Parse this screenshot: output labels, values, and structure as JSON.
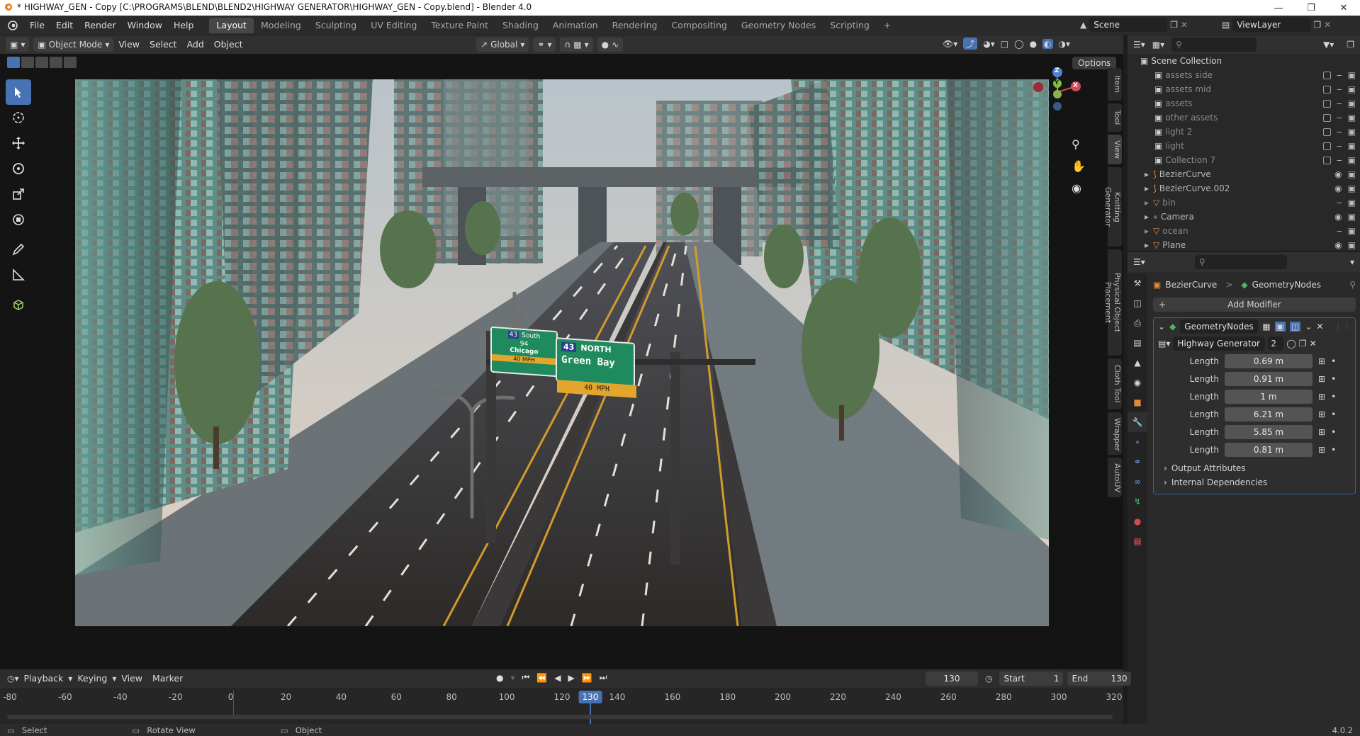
{
  "window": {
    "title": "* HIGHWAY_GEN - Copy [C:\\PROGRAMS\\BLEND\\BLEND2\\HIGHWAY GENERATOR\\HIGHWAY_GEN - Copy.blend] - Blender 4.0"
  },
  "menu": [
    "File",
    "Edit",
    "Render",
    "Window",
    "Help"
  ],
  "workspaces": [
    "Layout",
    "Modeling",
    "Sculpting",
    "UV Editing",
    "Texture Paint",
    "Shading",
    "Animation",
    "Rendering",
    "Compositing",
    "Geometry Nodes",
    "Scripting"
  ],
  "workspace_add": "+",
  "scene": {
    "name": "Scene",
    "view_layer": "ViewLayer"
  },
  "viewport": {
    "mode": "Object Mode",
    "menus": [
      "View",
      "Select",
      "Add",
      "Object"
    ],
    "transform_orientation": "Global",
    "options_label": "Options",
    "side_tabs": [
      "Item",
      "Tool",
      "View",
      "Knitting Generator",
      "Physical Object Placement",
      "Cloth Tool",
      "Wrapper",
      "AutoUV"
    ],
    "gizmo": {
      "z": "Z",
      "y": "Y",
      "x": "X"
    },
    "signs": {
      "left_route_top": "43",
      "left_route_bottom": "94",
      "left_south": "South",
      "left_city": "Chicago",
      "left_speed": "40 MPH",
      "right_route": "43",
      "right_dir": "NORTH",
      "right_city": "Green Bay",
      "right_speed": "40 MPH"
    }
  },
  "outliner": {
    "root": "Scene Collection",
    "items": [
      {
        "name": "assets side",
        "type": "collection",
        "dim": true
      },
      {
        "name": "assets mid",
        "type": "collection",
        "dim": true
      },
      {
        "name": "assets",
        "type": "collection",
        "dim": true
      },
      {
        "name": "other assets",
        "type": "collection",
        "dim": true
      },
      {
        "name": "light 2",
        "type": "collection",
        "dim": true
      },
      {
        "name": "light",
        "type": "collection",
        "dim": true
      },
      {
        "name": "Collection 7",
        "type": "collection",
        "dim": true
      },
      {
        "name": "BezierCurve",
        "type": "curve",
        "dim": false
      },
      {
        "name": "BezierCurve.002",
        "type": "curve",
        "dim": false
      },
      {
        "name": "bin",
        "type": "mesh",
        "dim": true
      },
      {
        "name": "Camera",
        "type": "camera",
        "dim": false
      },
      {
        "name": "ocean",
        "type": "mesh",
        "dim": true
      },
      {
        "name": "Plane",
        "type": "mesh",
        "dim": false
      }
    ]
  },
  "properties": {
    "breadcrumb_object": "BezierCurve",
    "breadcrumb_sep": ">",
    "breadcrumb_modifier": "GeometryNodes",
    "add_modifier": "Add Modifier",
    "modifier_name": "GeometryNodes",
    "node_group": "Highway Generator",
    "node_users": "2",
    "params": [
      {
        "label": "Length",
        "value": "0.69 m"
      },
      {
        "label": "Length",
        "value": "0.91 m"
      },
      {
        "label": "Length",
        "value": "1 m"
      },
      {
        "label": "Length",
        "value": "6.21 m"
      },
      {
        "label": "Length",
        "value": "5.85 m"
      },
      {
        "label": "Length",
        "value": "0.81 m"
      }
    ],
    "sections": [
      "Output Attributes",
      "Internal Dependencies"
    ]
  },
  "timeline": {
    "menus": [
      "Playback",
      "Keying",
      "View",
      "Marker"
    ],
    "current_frame": "130",
    "start_label": "Start",
    "start": "1",
    "end_label": "End",
    "end": "130",
    "ticks": [
      "-80",
      "-60",
      "-40",
      "-20",
      "0",
      "20",
      "40",
      "60",
      "80",
      "100",
      "120",
      "140",
      "160",
      "180",
      "200",
      "220",
      "240",
      "260",
      "280",
      "300",
      "320"
    ]
  },
  "status": {
    "select": "Select",
    "rotate": "Rotate View",
    "object": "Object",
    "version": "4.0.2"
  },
  "colors": {
    "accent": "#4772b3",
    "sign_green": "#1f8a5e",
    "sign_yellow": "#e3a52b"
  }
}
